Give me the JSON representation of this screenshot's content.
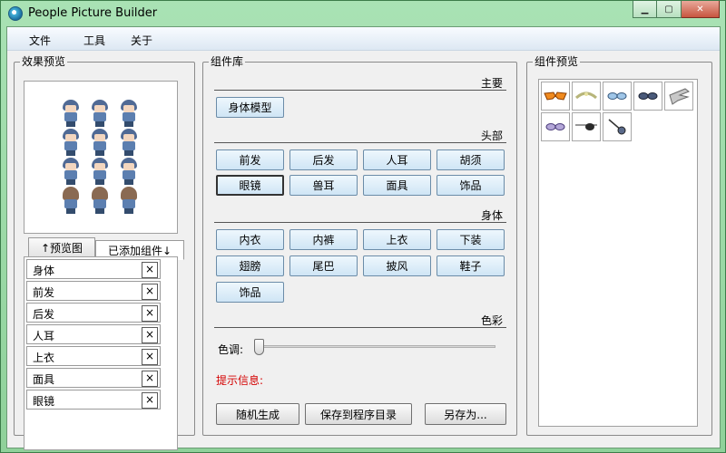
{
  "window": {
    "title": "People Picture Builder"
  },
  "menu": [
    "文件",
    "工具",
    "关于"
  ],
  "preview_panel": {
    "title": "效果预览",
    "tab_preview": "↑预览图",
    "tab_added": "已添加组件↓",
    "added_items": [
      "身体",
      "前发",
      "后发",
      "人耳",
      "上衣",
      "面具",
      "眼镜"
    ],
    "remove_glyph": "×"
  },
  "library_panel": {
    "title": "组件库",
    "sections": {
      "main": {
        "label": "主要",
        "buttons": [
          "身体模型"
        ]
      },
      "head": {
        "label": "头部",
        "buttons": [
          "前发",
          "后发",
          "人耳",
          "胡须",
          "眼镜",
          "兽耳",
          "面具",
          "饰品"
        ]
      },
      "body": {
        "label": "身体",
        "buttons": [
          "内衣",
          "内裤",
          "上衣",
          "下装",
          "翅膀",
          "尾巴",
          "披风",
          "鞋子",
          "饰品"
        ]
      },
      "color": {
        "label": "色彩"
      }
    },
    "hue_label": "色调:",
    "hue_value": 0,
    "hint_label": "提示信息:",
    "actions": [
      "随机生成",
      "保存到程序目录",
      "另存为..."
    ]
  },
  "component_preview": {
    "title": "组件预览",
    "thumbs": [
      "orange-glasses-icon",
      "tiara-icon",
      "blue-glasses-icon",
      "dark-glasses-icon",
      "wing-accessory-icon",
      "purple-glasses-icon",
      "eyepatch-icon",
      "monocle-icon"
    ]
  },
  "colors": {
    "accent": "#d40000",
    "title_bar": "#8fd19a",
    "component_button": "#cfe5f5"
  }
}
